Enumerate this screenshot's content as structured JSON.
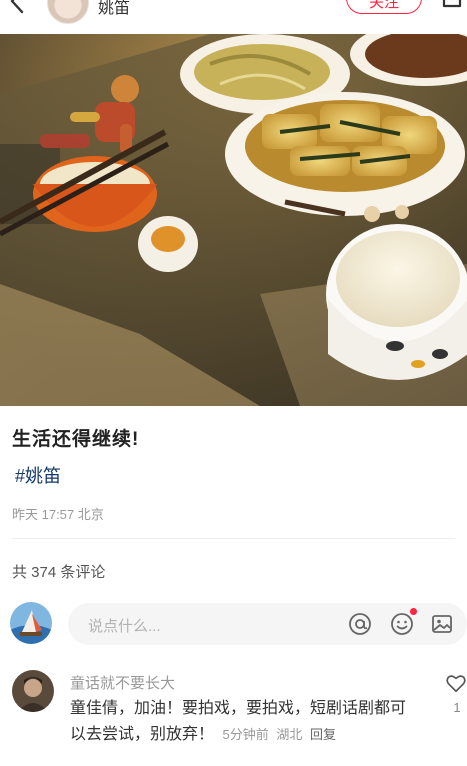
{
  "header": {
    "author_name": "姚笛",
    "follow_label": "关注"
  },
  "post": {
    "title": "生活还得继续!",
    "tag": "#姚笛",
    "time": "昨天 17:57",
    "location": "北京"
  },
  "comments_section": {
    "count_label": "共 374 条评论",
    "input_placeholder": "说点什么..."
  },
  "comment": {
    "author": "童话就不要长大",
    "text": "童佳倩，加油！要拍戏，要拍戏，短剧话剧都可以去尝试，别放弃！",
    "time": "5分钟前",
    "location": "湖北",
    "reply_label": "回复",
    "likes": "1"
  },
  "icons": [
    "back-icon",
    "share-icon",
    "at-icon",
    "emoji-icon",
    "image-icon",
    "heart-icon"
  ],
  "colors": {
    "accent": "#ff2442",
    "tag": "#13386c"
  }
}
